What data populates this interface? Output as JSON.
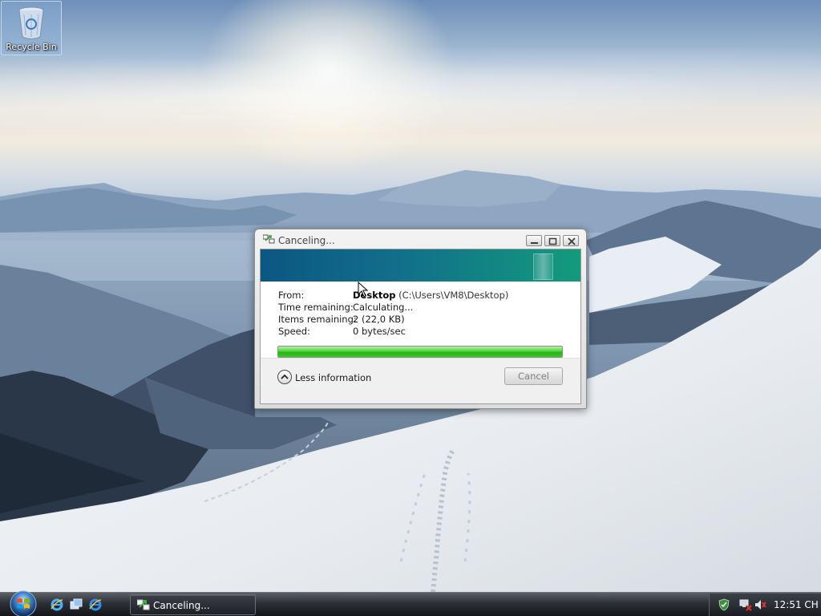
{
  "desktop": {
    "icons": [
      {
        "label": "Recycle Bin",
        "icon": "recycle-bin-icon"
      }
    ]
  },
  "dialog": {
    "title": "Canceling...",
    "title_icon": "file-transfer-icon",
    "caption_buttons": [
      "minimize",
      "maximize",
      "close"
    ],
    "info": {
      "from_label": "From:",
      "from_name": "Desktop",
      "from_path": "(C:\\Users\\VM8\\Desktop)",
      "time_label": "Time remaining:",
      "time_value": "Calculating...",
      "items_label": "Items remaining:",
      "items_value": "2 (22,0 KB)",
      "speed_label": "Speed:",
      "speed_value": "0 bytes/sec"
    },
    "progress_fraction": 1.0,
    "less_info_label": "Less information",
    "cancel_label": "Cancel",
    "cancel_enabled": false,
    "banner_colors": [
      "#0b5783",
      "#139b7c"
    ]
  },
  "taskbar": {
    "start_button": "windows-start-orb",
    "quick_launch": [
      "internet-explorer-icon",
      "switch-windows-icon",
      "internet-explorer-icon"
    ],
    "tasks": [
      {
        "label": "Canceling...",
        "icon": "file-transfer-icon",
        "active": true
      }
    ],
    "tray": {
      "icons": [
        "windows-security-icon",
        "network-disconnected-icon",
        "volume-muted-icon"
      ],
      "clock": "12:51 CH"
    }
  }
}
